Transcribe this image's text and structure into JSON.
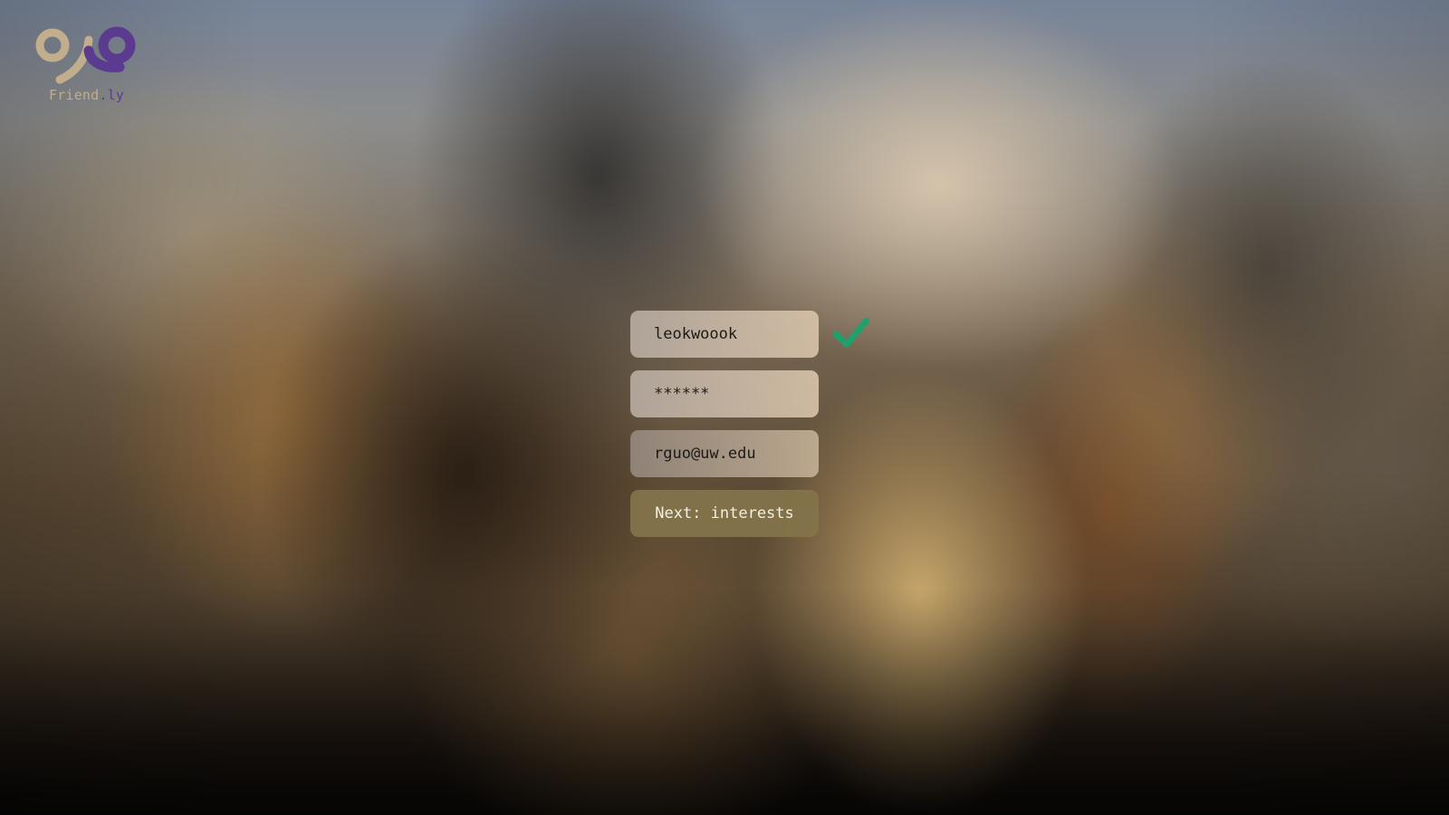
{
  "app": {
    "logo_text_part1": "Friend",
    "logo_text_part2": ".ly",
    "logo_icon": "friendly-logo-icon"
  },
  "signup": {
    "username_value": "leokwoook",
    "username_status_icon": "check-icon",
    "password_value": "******",
    "email_value": "rguo@uw.edu",
    "next_button_label": "Next: interests"
  },
  "colors": {
    "logo_tan": "#c2ad8c",
    "logo_purple": "#5b3b8f",
    "check_green": "#22a06b",
    "field_bg": "#d8c4aa",
    "button_bg": "#84744a",
    "button_text": "#f4efe6"
  }
}
